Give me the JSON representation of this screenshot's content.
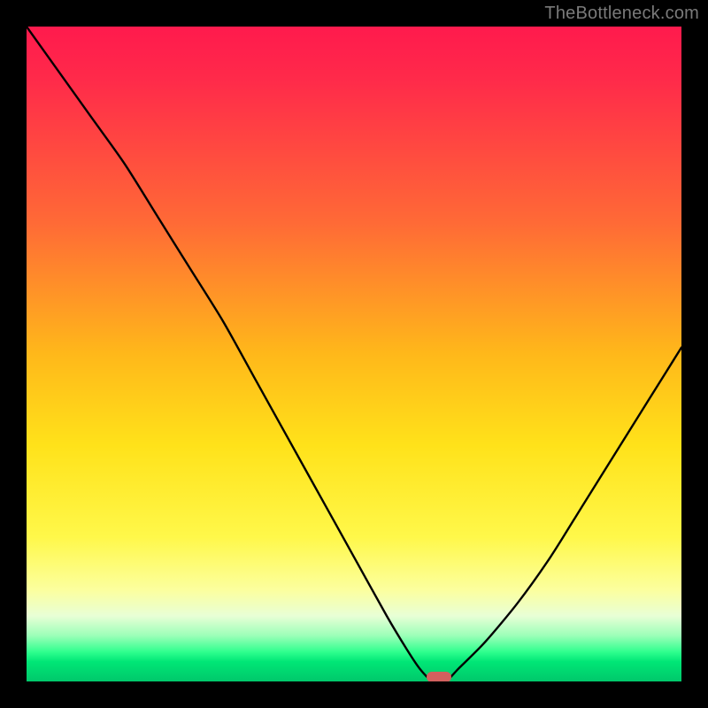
{
  "watermark": "TheBottleneck.com",
  "colors": {
    "background": "#000000",
    "curve": "#000000",
    "marker": "#d2605e",
    "watermark_text": "#7a7a7a"
  },
  "chart_data": {
    "type": "line",
    "title": "",
    "xlabel": "",
    "ylabel": "",
    "xlim": [
      0,
      100
    ],
    "ylim": [
      0,
      100
    ],
    "x": [
      0,
      5,
      10,
      15,
      20,
      25,
      30,
      35,
      40,
      45,
      50,
      55,
      58,
      60,
      62,
      64,
      66,
      70,
      75,
      80,
      85,
      90,
      95,
      100
    ],
    "values": [
      100,
      93,
      86,
      79,
      71,
      63,
      55,
      46,
      37,
      28,
      19,
      10,
      5,
      2,
      0,
      0,
      2,
      6,
      12,
      19,
      27,
      35,
      43,
      51
    ],
    "marker": {
      "x": 63,
      "y": 0
    },
    "grid": false,
    "legend": false,
    "background_gradient": {
      "direction": "vertical",
      "stops": [
        {
          "pos": 0.0,
          "color": "#ff1a4d"
        },
        {
          "pos": 0.5,
          "color": "#ffe21a"
        },
        {
          "pos": 0.97,
          "color": "#00e676"
        }
      ]
    }
  }
}
